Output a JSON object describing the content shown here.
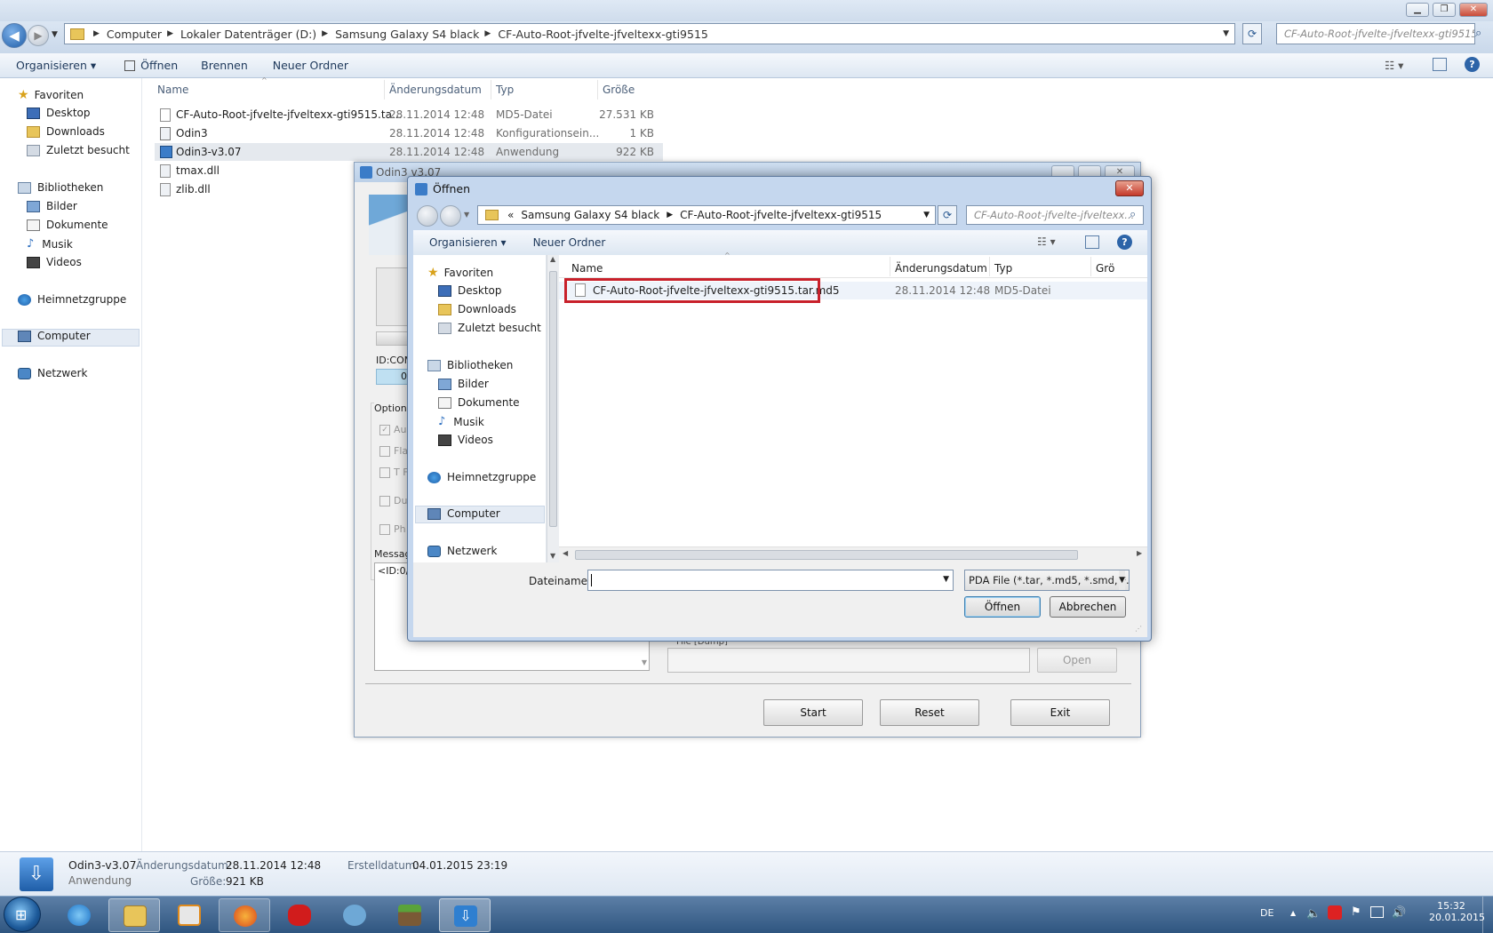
{
  "explorer": {
    "breadcrumb": [
      "Computer",
      "Lokaler Datenträger (D:)",
      "Samsung Galaxy S4 black",
      "CF-Auto-Root-jfvelte-jfveltexx-gti9515"
    ],
    "search_placeholder": "CF-Auto-Root-jfvelte-jfveltexx-gti9515...",
    "toolbar": {
      "organize": "Organisieren",
      "open": "Öffnen",
      "burn": "Brennen",
      "new_folder": "Neuer Ordner"
    },
    "nav": {
      "favorites": "Favoriten",
      "desktop": "Desktop",
      "downloads": "Downloads",
      "recent": "Zuletzt besucht",
      "libraries": "Bibliotheken",
      "pictures": "Bilder",
      "documents": "Dokumente",
      "music": "Musik",
      "videos": "Videos",
      "homegroup": "Heimnetzgruppe",
      "computer": "Computer",
      "network": "Netzwerk"
    },
    "columns": {
      "name": "Name",
      "date": "Änderungsdatum",
      "type": "Typ",
      "size": "Größe"
    },
    "files": [
      {
        "name": "CF-Auto-Root-jfvelte-jfveltexx-gti9515.ta...",
        "date": "28.11.2014 12:48",
        "type": "MD5-Datei",
        "size": "27.531 KB"
      },
      {
        "name": "Odin3",
        "date": "28.11.2014 12:48",
        "type": "Konfigurationsein...",
        "size": "1 KB"
      },
      {
        "name": "Odin3-v3.07",
        "date": "28.11.2014 12:48",
        "type": "Anwendung",
        "size": "922 KB"
      },
      {
        "name": "tmax.dll",
        "date": "",
        "type": "",
        "size": ""
      },
      {
        "name": "zlib.dll",
        "date": "",
        "type": "",
        "size": ""
      }
    ],
    "details": {
      "name": "Odin3-v3.07",
      "kind": "Anwendung",
      "modified_label": "Änderungsdatum:",
      "modified": "28.11.2014 12:48",
      "created_label": "Erstelldatum:",
      "created": "04.01.2015 23:19",
      "size_label": "Größe:",
      "size": "921 KB"
    }
  },
  "odin": {
    "title": "Odin3 v3.07",
    "id_com": "ID:COM",
    "id_value": "0",
    "option_label": "Option",
    "options": [
      "Au",
      "Fla",
      "T F",
      "Du",
      "Ph"
    ],
    "message_label": "Messag",
    "message_text": "<ID:0/",
    "file_dump": "File [Dump]",
    "open": "Open",
    "start": "Start",
    "reset": "Reset",
    "exit": "Exit"
  },
  "dialog": {
    "title": "Öffnen",
    "breadcrumb_prefix": "«",
    "breadcrumb": [
      "Samsung Galaxy S4 black",
      "CF-Auto-Root-jfvelte-jfveltexx-gti9515"
    ],
    "search_placeholder": "CF-Auto-Root-jfvelte-jfveltexx...",
    "toolbar": {
      "organize": "Organisieren",
      "new_folder": "Neuer Ordner"
    },
    "nav": {
      "favorites": "Favoriten",
      "desktop": "Desktop",
      "downloads": "Downloads",
      "recent": "Zuletzt besucht",
      "libraries": "Bibliotheken",
      "pictures": "Bilder",
      "documents": "Dokumente",
      "music": "Musik",
      "videos": "Videos",
      "homegroup": "Heimnetzgruppe",
      "computer": "Computer",
      "network": "Netzwerk"
    },
    "columns": {
      "name": "Name",
      "date": "Änderungsdatum",
      "type": "Typ",
      "size": "Grö"
    },
    "file": {
      "name": "CF-Auto-Root-jfvelte-jfveltexx-gti9515.tar.md5",
      "date": "28.11.2014 12:48",
      "type": "MD5-Datei"
    },
    "filename_label": "Dateiname:",
    "filename_value": "",
    "filter": "PDA File (*.tar, *.md5, *.smd, *.",
    "open_button": "Öffnen",
    "cancel_button": "Abbrechen"
  },
  "taskbar": {
    "language": "DE",
    "time": "15:32",
    "date": "20.01.2015"
  },
  "colors": {
    "accent": "#1f5ea8",
    "highlight_box": "#c8202a",
    "selection": "#dbe8f8"
  }
}
